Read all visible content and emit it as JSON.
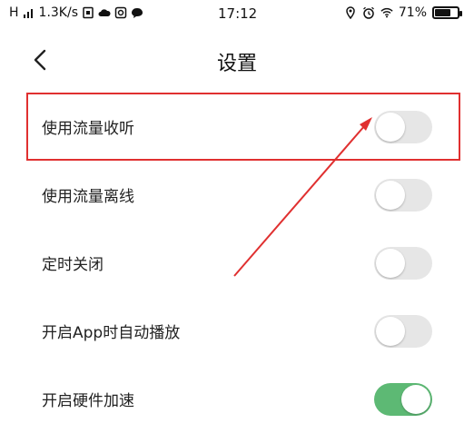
{
  "status_bar": {
    "carrier": "H",
    "network_speed": "1.3K/s",
    "time": "17:12",
    "battery_percent": "71%",
    "battery_level": 0.71,
    "left_icons": [
      "signal-icon",
      "sim-icon",
      "cloud-icon",
      "camera-icon",
      "message-icon"
    ],
    "right_icons": [
      "location-icon",
      "alarm-icon",
      "wifi-icon",
      "battery-icon"
    ]
  },
  "header": {
    "title": "设置",
    "back_icon": "chevron-left-icon"
  },
  "settings": [
    {
      "label": "使用流量收听",
      "enabled": false
    },
    {
      "label": "使用流量离线",
      "enabled": false
    },
    {
      "label": "定时关闭",
      "enabled": false
    },
    {
      "label": "开启App时自动播放",
      "enabled": false
    },
    {
      "label": "开启硬件加速",
      "enabled": true
    }
  ],
  "colors": {
    "toggle_on": "#5db974",
    "toggle_off": "#e6e6e6",
    "annotation": "#e03030"
  }
}
